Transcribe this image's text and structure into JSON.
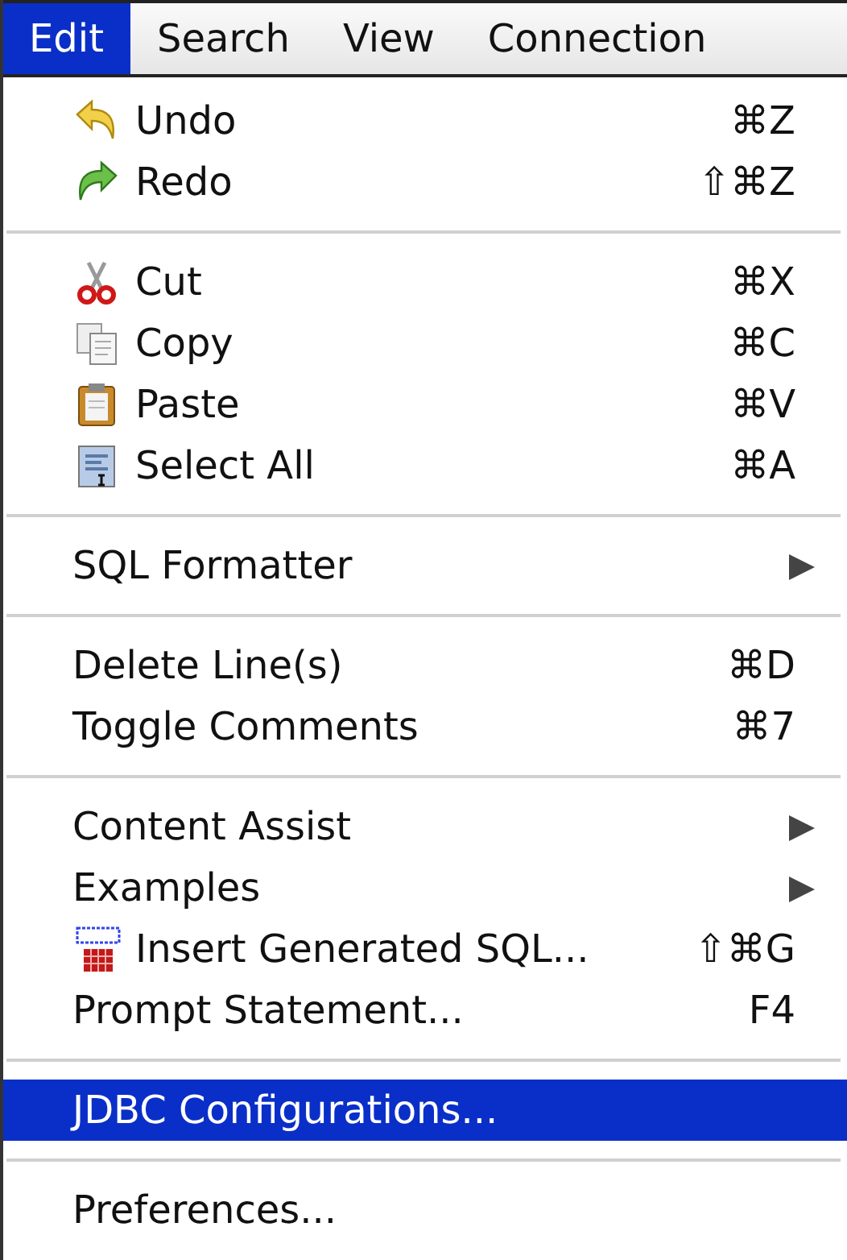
{
  "menu_bar": [
    {
      "label": "Edit",
      "selected": true
    },
    {
      "label": "Search",
      "selected": false
    },
    {
      "label": "View",
      "selected": false
    },
    {
      "label": "Connection",
      "selected": false
    }
  ],
  "menu": {
    "items": [
      {
        "kind": "item",
        "label": "Undo",
        "shortcut": "⌘Z",
        "selected": false
      },
      {
        "kind": "item",
        "label": "Redo",
        "shortcut": "⇧⌘Z",
        "selected": false
      },
      {
        "kind": "separator"
      },
      {
        "kind": "item",
        "label": "Cut",
        "shortcut": "⌘X",
        "selected": false
      },
      {
        "kind": "item",
        "label": "Copy",
        "shortcut": "⌘C",
        "selected": false
      },
      {
        "kind": "item",
        "label": "Paste",
        "shortcut": "⌘V",
        "selected": false
      },
      {
        "kind": "item",
        "label": "Select All",
        "shortcut": "⌘A",
        "selected": false
      },
      {
        "kind": "separator"
      },
      {
        "kind": "submenu",
        "label": "SQL Formatter",
        "selected": false
      },
      {
        "kind": "separator"
      },
      {
        "kind": "item",
        "label": "Delete Line(s)",
        "shortcut": "⌘D",
        "selected": false
      },
      {
        "kind": "item",
        "label": "Toggle Comments",
        "shortcut": "⌘7",
        "selected": false
      },
      {
        "kind": "separator"
      },
      {
        "kind": "submenu",
        "label": "Content Assist",
        "selected": false
      },
      {
        "kind": "submenu",
        "label": "Examples",
        "selected": false
      },
      {
        "kind": "item",
        "label": "Insert Generated SQL...",
        "shortcut": "⇧⌘G",
        "selected": false
      },
      {
        "kind": "item",
        "label": "Prompt Statement...",
        "shortcut": "F4",
        "selected": false
      },
      {
        "kind": "separator"
      },
      {
        "kind": "item",
        "label": "JDBC Configurations...",
        "selected": true
      },
      {
        "kind": "separator"
      },
      {
        "kind": "item",
        "label": "Preferences...",
        "selected": false
      }
    ]
  }
}
